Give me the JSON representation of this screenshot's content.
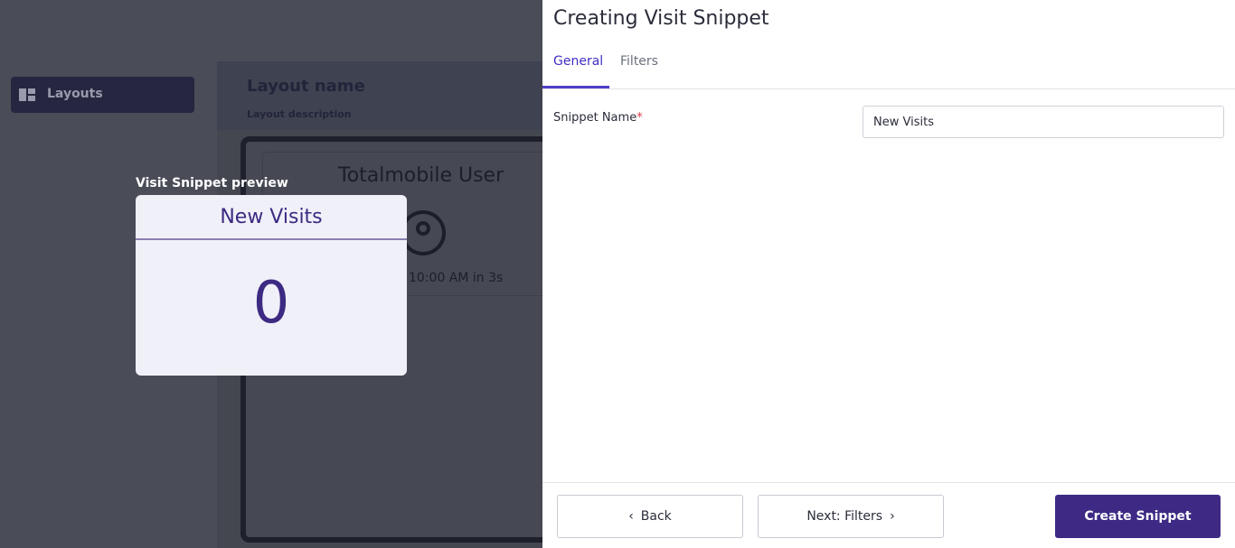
{
  "background": {
    "sidebar": {
      "items": [
        {
          "label": "Layouts",
          "icon": "layouts-icon"
        }
      ]
    },
    "layout": {
      "name": "Layout name",
      "description": "Layout description",
      "user_title": "Totalmobile User",
      "time_text": "10:00 AM in 3s"
    }
  },
  "preview": {
    "label": "Visit Snippet preview",
    "title": "New Visits",
    "value": "0"
  },
  "drawer": {
    "title": "Creating Visit Snippet",
    "tabs": [
      {
        "label": "General",
        "active": true
      },
      {
        "label": "Filters",
        "active": false
      }
    ],
    "form": {
      "snippet_name_label": "Snippet Name",
      "required_marker": "*",
      "snippet_name_value": "New Visits"
    },
    "footer": {
      "back_label": "Back",
      "next_label": "Next: Filters",
      "create_label": "Create Snippet"
    }
  },
  "colors": {
    "accent": "#3e2a85",
    "tab_active": "#3d2ec4",
    "required": "#e0384a",
    "preview_bg": "#f0f0f9"
  }
}
